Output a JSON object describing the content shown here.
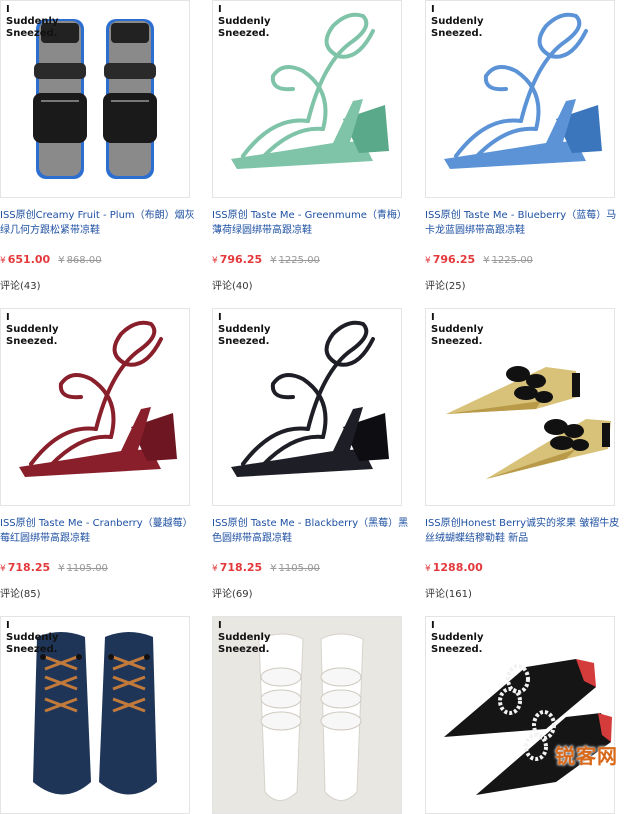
{
  "brand_label": "I\nSuddenly\nSneezed.",
  "currency": "¥",
  "products": [
    {
      "title": "ISS原创Creamy Fruit - Plum（布朗）烟灰绿几何方跟松紧带凉鞋",
      "price": "651.00",
      "original_price": "868.00",
      "reviews": "评论(43)",
      "shoe": "slide-black"
    },
    {
      "title": "ISS原创 Taste Me - Greenmume（青梅）薄荷绿圆绑带高跟凉鞋",
      "price": "796.25",
      "original_price": "1225.00",
      "reviews": "评论(40)",
      "shoe": "strappy-mint"
    },
    {
      "title": "ISS原创 Taste Me - Blueberry（蓝莓）马卡龙蓝圆绑带高跟凉鞋",
      "price": "796.25",
      "original_price": "1225.00",
      "reviews": "评论(25)",
      "shoe": "strappy-blue"
    },
    {
      "title": "ISS原创 Taste Me - Cranberry（蔓越莓）莓红圆绑带高跟凉鞋",
      "price": "718.25",
      "original_price": "1105.00",
      "reviews": "评论(85)",
      "shoe": "strappy-burgundy"
    },
    {
      "title": "ISS原创 Taste Me - Blackberry（黑莓）黑色圆绑带高跟凉鞋",
      "price": "718.25",
      "original_price": "1105.00",
      "reviews": "评论(69)",
      "shoe": "strappy-black"
    },
    {
      "title": "ISS原创Honest Berry诚实的浆果 皱褶牛皮丝绒蝴蝶结穆勒鞋 新品",
      "price": "1288.00",
      "original_price": "",
      "reviews": "评论(161)",
      "shoe": "mule-gold"
    },
    {
      "title": "",
      "price": "",
      "original_price": "",
      "reviews": "",
      "shoe": "flat-navy"
    },
    {
      "title": "",
      "price": "",
      "original_price": "",
      "reviews": "",
      "shoe": "mule-white"
    },
    {
      "title": "",
      "price": "",
      "original_price": "",
      "reviews": "",
      "shoe": "mule-black-jewel"
    }
  ],
  "watermark": "锐客网",
  "colors": {
    "link": "#1e50a2",
    "price": "#e4393c",
    "muted": "#999999"
  }
}
